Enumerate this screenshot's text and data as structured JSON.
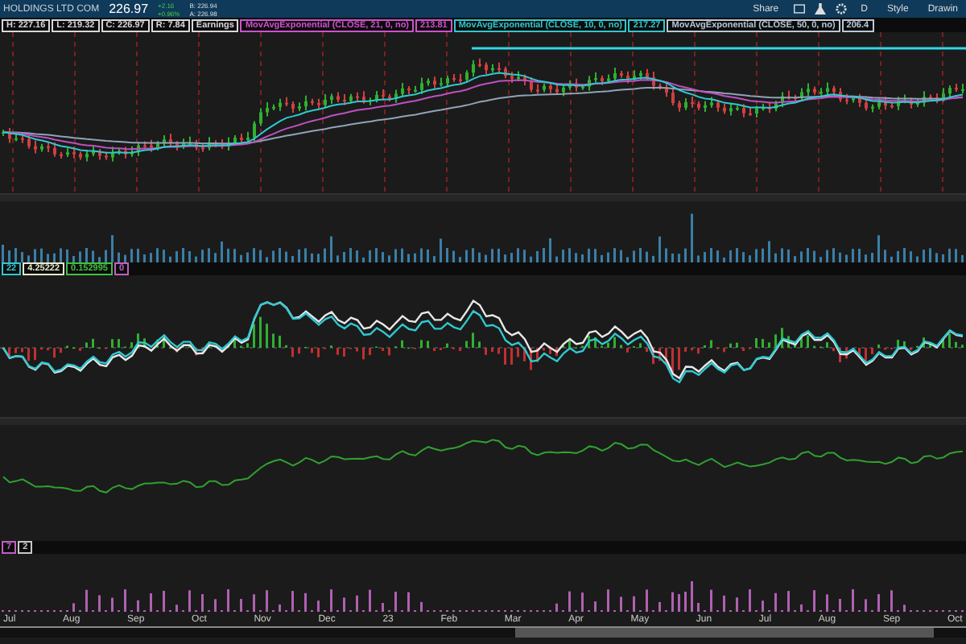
{
  "header": {
    "symbol": "HOLDINGS LTD COM",
    "price": "226.97",
    "change": "+2.16",
    "change_percent": "+0.96%",
    "bid": "B: 226.94",
    "ask": "A: 226.98"
  },
  "toolbar": {
    "share": "Share",
    "aggregation": "D",
    "style": "Style",
    "drawings": "Drawin"
  },
  "legend": [
    {
      "text": "H: 227.16",
      "color": "#d8d8d8"
    },
    {
      "text": "L: 219.32",
      "color": "#d8d8d8"
    },
    {
      "text": "C: 226.97",
      "color": "#d8d8d8"
    },
    {
      "text": "R: 7.84",
      "color": "#d8d8d8"
    },
    {
      "text": "Earnings",
      "color": "#d8d8d8"
    },
    {
      "text": "MovAvgExponential (CLOSE, 21, 0, no)",
      "color": "#d050d0"
    },
    {
      "text": "213.81",
      "color": "#d050d0"
    },
    {
      "text": "MovAvgExponential (CLOSE, 10, 0, no)",
      "color": "#30c8d0"
    },
    {
      "text": "217.27",
      "color": "#30c8d0"
    },
    {
      "text": "MovAvgExponential (CLOSE, 50, 0, no)",
      "color": "#b8c8d8"
    },
    {
      "text": "206.4",
      "color": "#b8c8d8"
    }
  ],
  "oscillator_legend": [
    {
      "text": "22",
      "color": "#30c8d0"
    },
    {
      "text": "4.25222",
      "color": "#e8e8c8"
    },
    {
      "text": "0.152995",
      "color": "#40c040"
    },
    {
      "text": "0",
      "color": "#c060c0"
    }
  ],
  "histogram_legend": [
    {
      "text": "7",
      "color": "#c060c0"
    },
    {
      "text": "2",
      "color": "#c8c8c8"
    }
  ],
  "x_axis": [
    "Jul",
    "Aug",
    "Sep",
    "Oct",
    "Nov",
    "Dec",
    "23",
    "Feb",
    "Mar",
    "Apr",
    "May",
    "Jun",
    "Jul",
    "Aug",
    "Sep",
    "Oct"
  ]
}
